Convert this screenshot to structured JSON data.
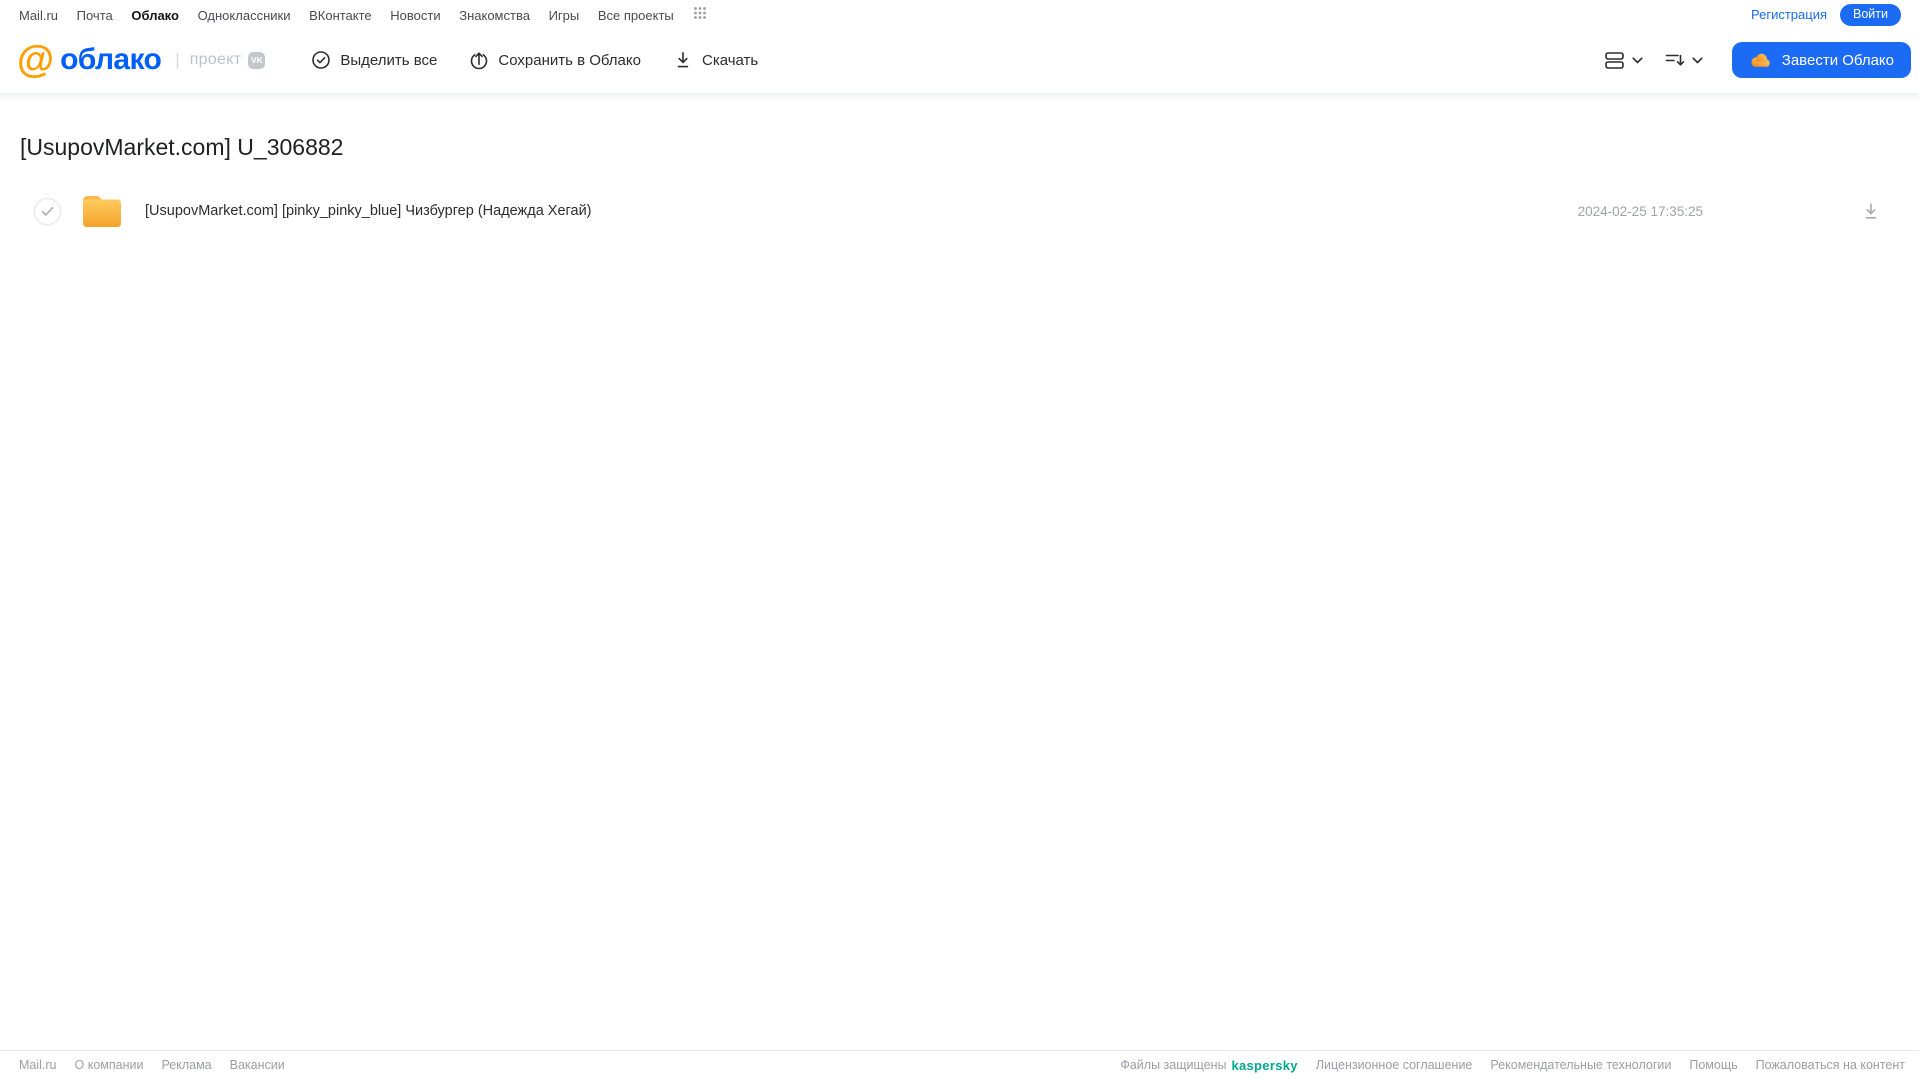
{
  "colors": {
    "accent-blue": "#1b6bf5",
    "logo-blue": "#005ff9",
    "logo-orange": "#ff9e00",
    "kaspersky-green": "#00a88e",
    "folder-light": "#ffc95f",
    "folder-dark": "#f4a42c",
    "text-dark": "#2c2d2e",
    "text-muted": "#9c9ea3"
  },
  "topbar": {
    "links": [
      {
        "label": "Mail.ru"
      },
      {
        "label": "Почта"
      },
      {
        "label": "Облако",
        "active": true
      },
      {
        "label": "Одноклассники"
      },
      {
        "label": "ВКонтакте"
      },
      {
        "label": "Новости"
      },
      {
        "label": "Знакомства"
      },
      {
        "label": "Игры"
      },
      {
        "label": "Все проекты"
      }
    ],
    "register_label": "Регистрация",
    "login_label": "Войти"
  },
  "header": {
    "logo_at": "@",
    "logo_text": "облако",
    "project_label": "проект",
    "vk_badge_label": "VK",
    "toolbar": [
      {
        "label": "Выделить все",
        "icon": "check-circle-icon"
      },
      {
        "label": "Сохранить в Облако",
        "icon": "cloud-upload-icon"
      },
      {
        "label": "Скачать",
        "icon": "download-icon"
      }
    ],
    "view_control_icon": "list-view-icon",
    "sort_control_icon": "sort-icon",
    "get_cloud_label": "Завести Облако"
  },
  "main": {
    "title": "[UsupovMarket.com] U_306882",
    "files": [
      {
        "type": "folder",
        "name": "[UsupovMarket.com] [pinky_pinky_blue] Чизбургер (Надежда Хегай)",
        "date": "2024-02-25 17:35:25"
      }
    ]
  },
  "footer": {
    "left_links": [
      "Mail.ru",
      "О компании",
      "Реклама",
      "Вакансии"
    ],
    "protected_label": "Файлы защищены",
    "kaspersky_label": "kaspersky",
    "right_links": [
      "Лицензионное соглашение",
      "Рекомендательные технологии",
      "Помощь",
      "Пожаловаться на контент"
    ]
  }
}
